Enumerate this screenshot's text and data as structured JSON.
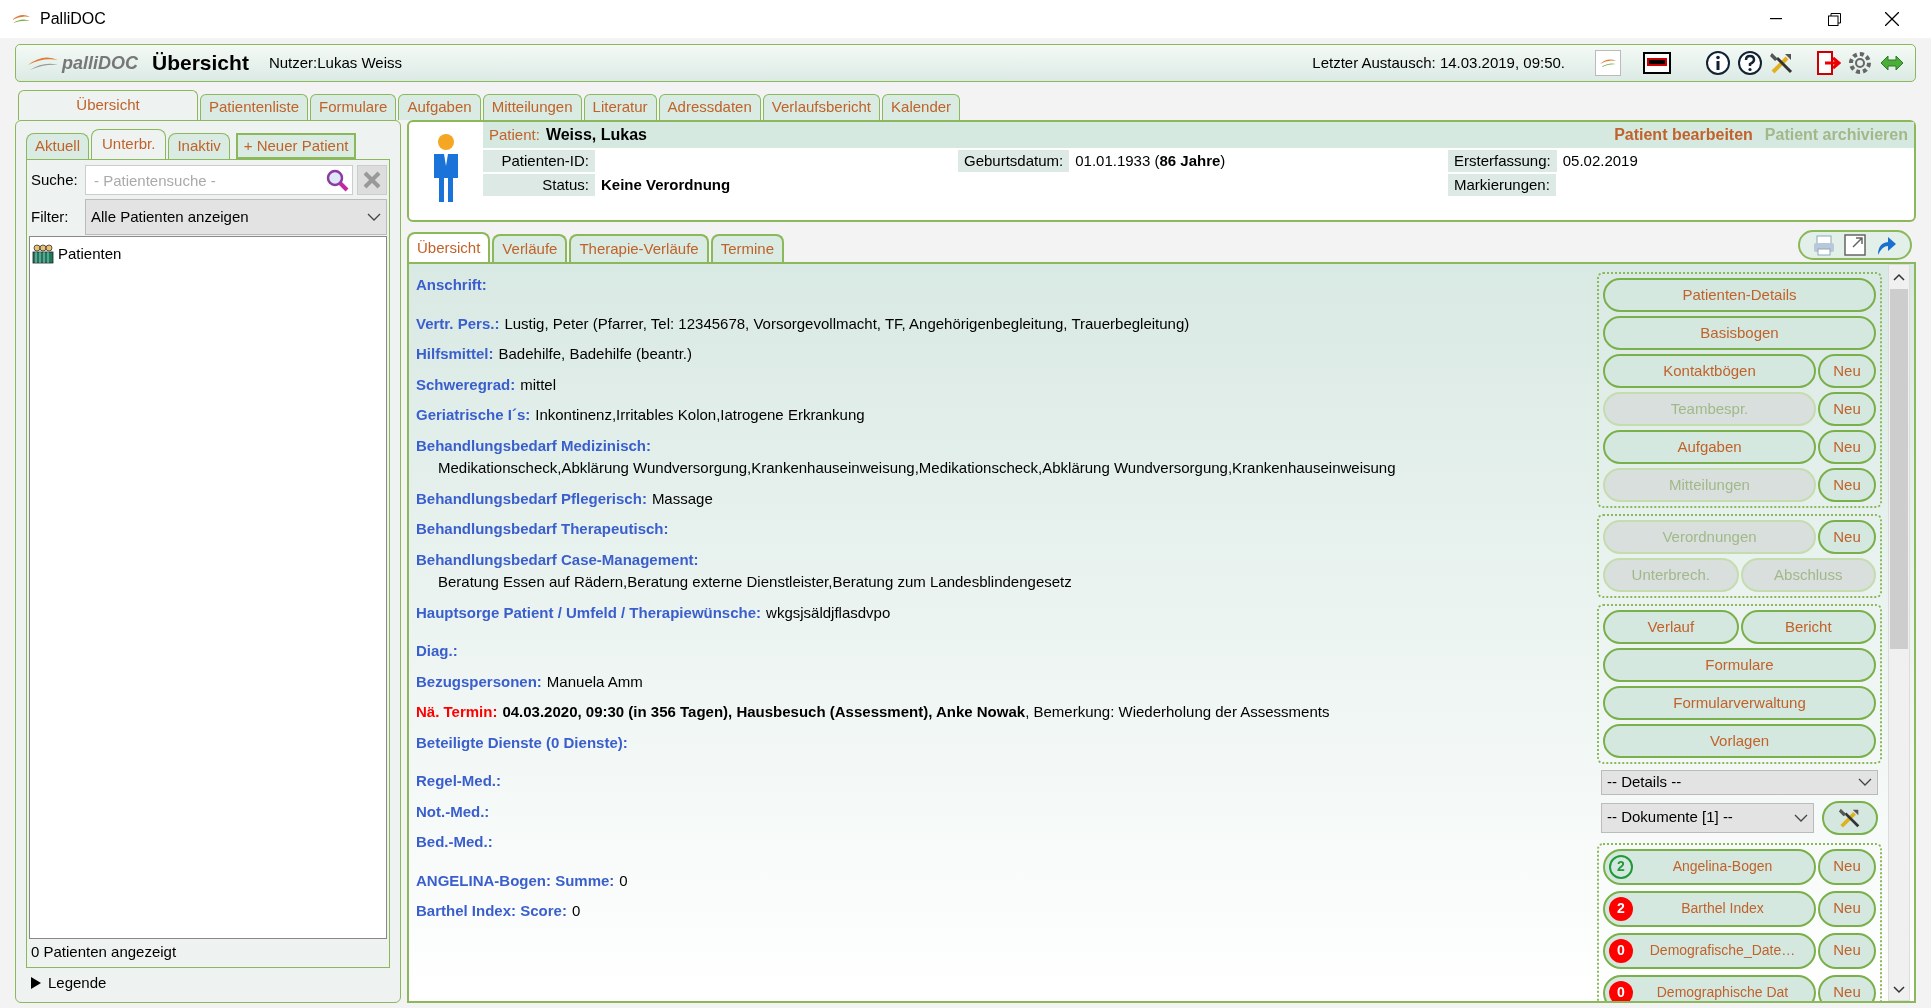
{
  "window": {
    "title": "PalliDOC"
  },
  "toolbar": {
    "app_name": "palliDOC",
    "page_title": "Übersicht",
    "user": "Nutzer:Lukas Weiss",
    "last_exchange": "Letzter Austausch: 14.03.2019, 09:50."
  },
  "main_tabs": [
    {
      "label": "Übersicht",
      "selected": true
    },
    {
      "label": "Patientenliste",
      "selected": false
    },
    {
      "label": "Formulare",
      "selected": false
    },
    {
      "label": "Aufgaben",
      "selected": false
    },
    {
      "label": "Mitteilungen",
      "selected": false
    },
    {
      "label": "Literatur",
      "selected": false
    },
    {
      "label": "Adressdaten",
      "selected": false
    },
    {
      "label": "Verlaufsbericht",
      "selected": false
    },
    {
      "label": "Kalender",
      "selected": false
    }
  ],
  "patient_list": {
    "tabs": [
      {
        "label": "Aktuell",
        "selected": false
      },
      {
        "label": "Unterbr.",
        "selected": true
      },
      {
        "label": "Inaktiv",
        "selected": false
      }
    ],
    "new_button": "+ Neuer Patient",
    "search": {
      "label": "Suche:",
      "placeholder": "- Patientensuche -"
    },
    "filter": {
      "label": "Filter:",
      "value": "Alle Patienten anzeigen"
    },
    "tree": [
      {
        "label": "Patienten"
      }
    ],
    "count_text": "0 Patienten angezeigt",
    "legend": {
      "label": "Legende",
      "expanded": false
    }
  },
  "patient": {
    "label": "Patient:",
    "name": "Weiss, Lukas",
    "actions": [
      {
        "label": "Patient bearbeiten",
        "disabled": false
      },
      {
        "label": "Patient archivieren",
        "disabled": true
      }
    ],
    "columns": [
      [
        {
          "label": "Patienten-ID:"
        },
        {
          "label": "Status:",
          "value": "**Keine Verordnung**"
        }
      ],
      [
        {
          "label": "Geburtsdatum:",
          "value": "01.01.1933 (**86 Jahre**)"
        }
      ],
      [
        {
          "label": "Ersterfassung:",
          "value": "05.02.2019"
        },
        {
          "label": "Markierungen:"
        }
      ]
    ]
  },
  "detail_tabs": [
    {
      "label": "Übersicht",
      "selected": true
    },
    {
      "label": "Verläufe",
      "selected": false
    },
    {
      "label": "Therapie-Verläufe",
      "selected": false
    },
    {
      "label": "Termine",
      "selected": false
    }
  ],
  "overview": {
    "groups": [
      [
        {
          "label": "Anschrift:",
          "kind": "inline"
        }
      ],
      [
        {
          "label": "Vertr. Pers.:",
          "value": "Lustig, Peter (Pfarrer, Tel: 12345678, Vorsorgevollmacht, TF, Angehörigenbegleitung, Trauerbegleitung)",
          "kind": "inline"
        },
        {
          "label": "Hilfsmittel:",
          "value": "Badehilfe, Badehilfe (beantr.)",
          "kind": "inline"
        },
        {
          "label": "Schweregrad:",
          "value": "mittel",
          "kind": "inline"
        },
        {
          "label": "Geriatrische I´s:",
          "value": "Inkontinenz,Irritables Kolon,Iatrogene Erkrankung",
          "kind": "inline"
        },
        {
          "label": "Behandlungsbedarf Medizinisch:",
          "value": "Medikationscheck,Abklärung Wundversorgung,Krankenhauseinweisung,Medikationscheck,Abklärung Wundversorgung,Krankenhauseinweisung",
          "kind": "block"
        },
        {
          "label": "Behandlungsbedarf Pflegerisch:",
          "value": "Massage",
          "kind": "inline"
        },
        {
          "label": "Behandlungsbedarf Therapeutisch:",
          "kind": "inline"
        },
        {
          "label": "Behandlungsbedarf Case-Management:",
          "value": "Beratung Essen auf Rädern,Beratung externe Dienstleister,Beratung zum Landesblindengesetz",
          "kind": "block"
        },
        {
          "label": "Hauptsorge Patient / Umfeld / Therapiewünsche:",
          "value": "wkgsjsäldjflasdvpo",
          "kind": "inline"
        }
      ],
      [
        {
          "label": "Diag.:",
          "kind": "inline"
        },
        {
          "label": "Bezugspersonen:",
          "value": "Manuela Amm",
          "kind": "inline"
        },
        {
          "label": "Nä. Termin:",
          "value": "**04.03.2020, 09:30 (in 356 Tagen), Hausbesuch (Assessment), Anke Nowak**, Bemerkung: Wiederholung der Assessments",
          "kind": "alert"
        },
        {
          "label": "Beteiligte Dienste (0 Dienste):",
          "kind": "inline"
        }
      ],
      [
        {
          "label": "Regel-Med.:",
          "kind": "inline"
        },
        {
          "label": "Not.-Med.:",
          "kind": "inline"
        },
        {
          "label": "Bed.-Med.:",
          "kind": "inline"
        }
      ],
      [
        {
          "label": "ANGELINA-Bogen: Summe:",
          "value": "0",
          "kind": "inline"
        },
        {
          "label": "Barthel Index: Score:",
          "value": "0",
          "kind": "inline"
        }
      ]
    ]
  },
  "action_panel": {
    "groups": [
      [
        {
          "kind": "full",
          "buttons": [
            {
              "label": "Patienten-Details",
              "disabled": false
            }
          ]
        },
        {
          "kind": "full",
          "buttons": [
            {
              "label": "Basisbogen",
              "disabled": false
            }
          ]
        },
        {
          "kind": "split",
          "buttons": [
            {
              "label": "Kontaktbögen",
              "disabled": false
            },
            {
              "label": "Neu",
              "disabled": false
            }
          ]
        },
        {
          "kind": "split",
          "buttons": [
            {
              "label": "Teambespr.",
              "disabled": true
            },
            {
              "label": "Neu",
              "disabled": false
            }
          ]
        },
        {
          "kind": "split",
          "buttons": [
            {
              "label": "Aufgaben",
              "disabled": false
            },
            {
              "label": "Neu",
              "disabled": false
            }
          ]
        },
        {
          "kind": "split",
          "buttons": [
            {
              "label": "Mitteilungen",
              "disabled": true
            },
            {
              "label": "Neu",
              "disabled": false
            }
          ]
        }
      ],
      [
        {
          "kind": "split",
          "buttons": [
            {
              "label": "Verordnungen",
              "disabled": true
            },
            {
              "label": "Neu",
              "disabled": false
            }
          ]
        },
        {
          "kind": "pair",
          "buttons": [
            {
              "label": "Unterbrech.",
              "disabled": true
            },
            {
              "label": "Abschluss",
              "disabled": true
            }
          ]
        }
      ],
      [
        {
          "kind": "pair",
          "buttons": [
            {
              "label": "Verlauf",
              "disabled": false
            },
            {
              "label": "Bericht",
              "disabled": false
            }
          ]
        },
        {
          "kind": "full",
          "buttons": [
            {
              "label": "Formulare",
              "disabled": false
            }
          ]
        },
        {
          "kind": "full",
          "buttons": [
            {
              "label": "Formularverwaltung",
              "disabled": false
            }
          ]
        },
        {
          "kind": "full",
          "buttons": [
            {
              "label": "Vorlagen",
              "disabled": false
            }
          ]
        }
      ]
    ],
    "details_select": "-- Details --",
    "documents_select": "-- Dokumente [1] --",
    "forms": [
      {
        "badge": "2",
        "kind": "outline",
        "color": "#1f9a3a",
        "label": "Angelina-Bogen",
        "new_label": "Neu"
      },
      {
        "badge": "2",
        "kind": "filled",
        "color": "#ff0000",
        "label": "Barthel Index",
        "new_label": "Neu"
      },
      {
        "badge": "0",
        "kind": "filled",
        "color": "#ff0000",
        "label": "Demografische_Date…",
        "new_label": "Neu"
      },
      {
        "badge": "0",
        "kind": "filled",
        "color": "#ff0000",
        "label": "Demographische Dat",
        "new_label": "Neu"
      }
    ]
  }
}
